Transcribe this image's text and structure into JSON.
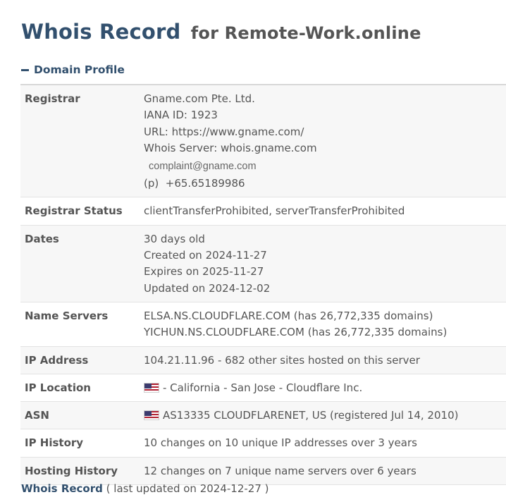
{
  "header": {
    "title": "Whois Record",
    "subtitle": "for Remote-Work.online"
  },
  "section": {
    "toggle_label": "Domain Profile"
  },
  "rows": {
    "registrar": {
      "label": "Registrar",
      "lines": [
        "Gname.com Pte. Ltd.",
        "IANA ID: 1923",
        "URL: https://www.gname.com/",
        "Whois Server: whois.gname.com"
      ],
      "email": "complaint@gname.com",
      "phone_prefix": "(p)",
      "phone": "+65.65189986"
    },
    "registrar_status": {
      "label": "Registrar Status",
      "value": "clientTransferProhibited, serverTransferProhibited"
    },
    "dates": {
      "label": "Dates",
      "lines": [
        "30 days old",
        "Created on 2024-11-27",
        "Expires on 2025-11-27",
        "Updated on 2024-12-02"
      ]
    },
    "name_servers": {
      "label": "Name Servers",
      "lines": [
        "ELSA.NS.CLOUDFLARE.COM (has 26,772,335 domains)",
        "YICHUN.NS.CLOUDFLARE.COM (has 26,772,335 domains)"
      ]
    },
    "ip_address": {
      "label": "IP Address",
      "value": "104.21.11.96 - 682 other sites hosted on this server"
    },
    "ip_location": {
      "label": "IP Location",
      "value": "- California - San Jose - Cloudflare Inc.",
      "icon": "us-flag-icon"
    },
    "asn": {
      "label": "ASN",
      "value": "AS13335 CLOUDFLARENET, US (registered Jul 14, 2010)",
      "icon": "us-flag-icon"
    },
    "ip_history": {
      "label": "IP History",
      "value": "10 changes on 10 unique IP addresses over 3 years"
    },
    "hosting_history": {
      "label": "Hosting History",
      "value": "12 changes on 7 unique name servers over 6 years"
    }
  },
  "footer": {
    "link": "Whois Record",
    "updated": "( last updated on 2024-12-27 )"
  },
  "colors": {
    "heading": "#32506e",
    "text": "#555555",
    "row_shade": "#f7f7f7",
    "border": "#e3e3e3"
  }
}
